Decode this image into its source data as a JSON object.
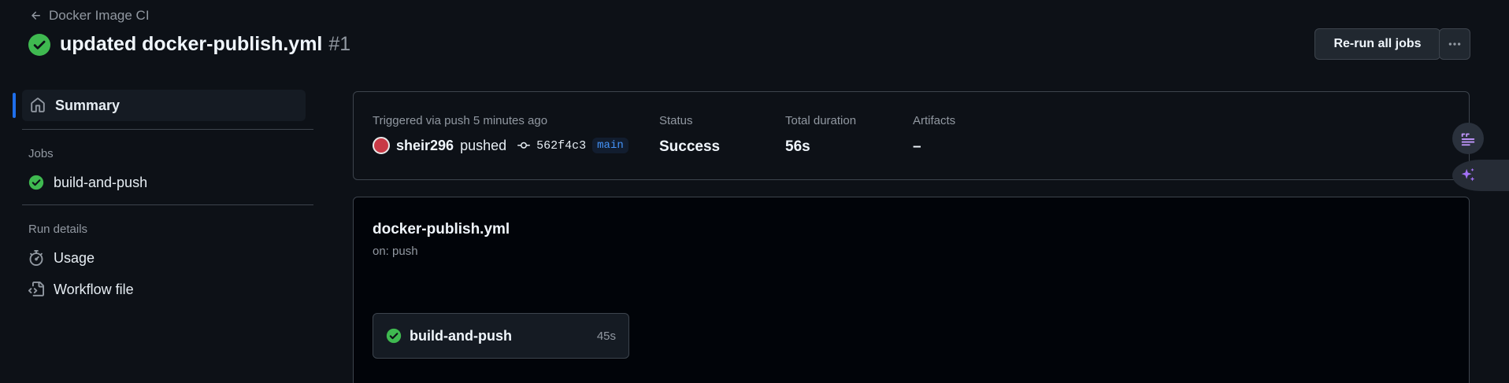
{
  "header": {
    "back_label": "Docker Image CI",
    "title": "updated docker-publish.yml",
    "run_number": "#1",
    "rerun_label": "Re-run all jobs"
  },
  "sidebar": {
    "summary_label": "Summary",
    "jobs_heading": "Jobs",
    "jobs": [
      {
        "label": "build-and-push",
        "status": "success"
      }
    ],
    "run_details_heading": "Run details",
    "usage_label": "Usage",
    "workflow_file_label": "Workflow file"
  },
  "summary": {
    "trigger_label": "Triggered via push 5 minutes ago",
    "user": "sheir296",
    "action": "pushed",
    "commit_sha": "562f4c3",
    "branch": "main",
    "status_label": "Status",
    "status_value": "Success",
    "duration_label": "Total duration",
    "duration_value": "56s",
    "artifacts_label": "Artifacts",
    "artifacts_value": "–"
  },
  "workflow": {
    "file_name": "docker-publish.yml",
    "trigger": "on: push",
    "job": {
      "name": "build-and-push",
      "duration": "45s"
    }
  },
  "colors": {
    "background": "#0d1117",
    "success": "#3fb950",
    "accent": "#1f6feb",
    "branch_text": "#4493f8",
    "copilot_purple": "#a371f7"
  },
  "icons": {
    "back": "arrow-left-icon",
    "status": "check-circle-icon",
    "more": "kebab-horizontal-icon",
    "summary": "home-icon",
    "usage": "stopwatch-icon",
    "workflow_file": "file-code-icon",
    "commit": "git-commit-icon",
    "float_1": "quote-list-icon",
    "float_2": "sparkles-icon"
  }
}
